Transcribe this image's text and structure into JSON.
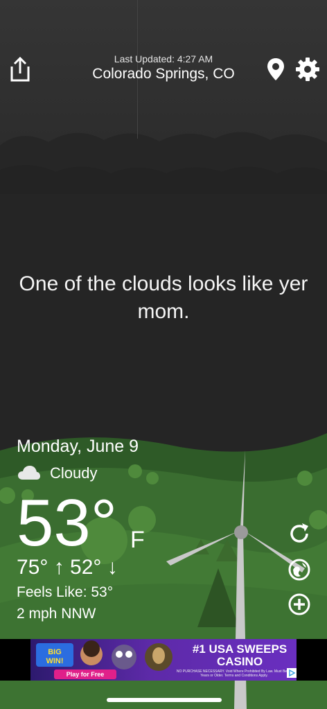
{
  "header": {
    "last_updated": "Last Updated: 4:27 AM",
    "city": "Colorado Springs, CO"
  },
  "quote": "One of the clouds looks like yer mom.",
  "current": {
    "date": "Monday, June 9",
    "condition": "Cloudy",
    "condition_icon": "cloud-icon",
    "temperature": "53°",
    "unit": "F",
    "hi_lo": "75° ↑ 52° ↓",
    "feels_like": "Feels Like: 53°",
    "wind": "2 mph NNW"
  },
  "actions": [
    "share-icon",
    "location-pin-icon",
    "gear-icon",
    "refresh-icon",
    "globe-icon",
    "add-icon"
  ],
  "ad": {
    "headline": "#1 USA SWEEPS CASINO",
    "cta": "Play for Free",
    "badge": "BIG WIN!",
    "disclaimer": "NO PURCHASE NECESSARY. Void Where Prohibited By Law. Must Be 21 Years or Older. Terms and Conditions Apply."
  },
  "colors": {
    "sky": "#2a2a2a",
    "hills": "#3f7a32",
    "ad_bg": "#5d2aa8",
    "ad_cta": "#e0208a"
  }
}
